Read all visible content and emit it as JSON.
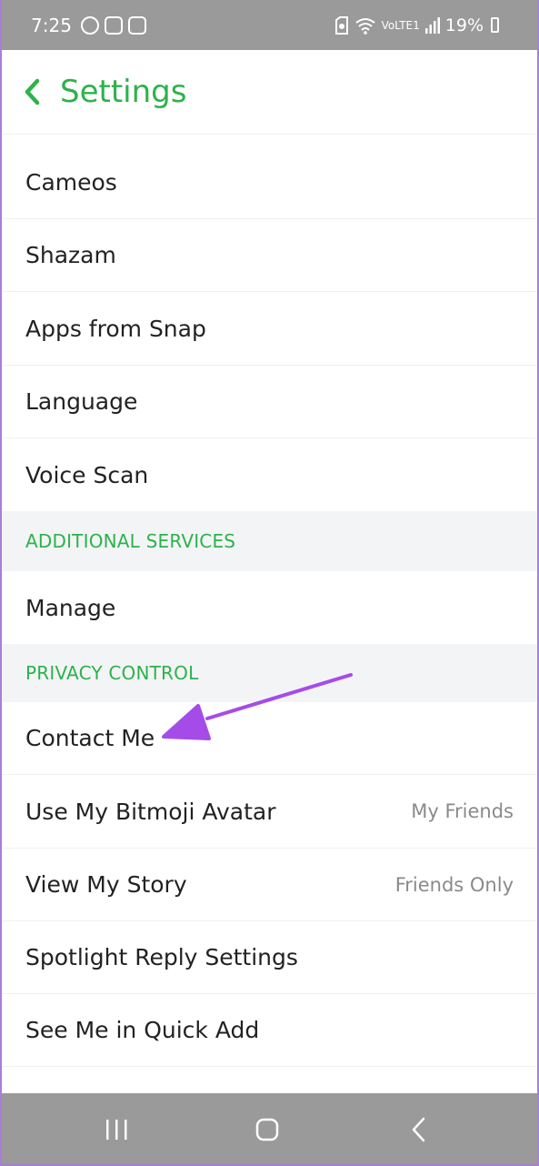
{
  "status_bar": {
    "time": "7:25",
    "battery": "19%",
    "network": "VoLTE1",
    "icons": [
      "whatsapp-icon",
      "instagram-icon",
      "gallery-icon",
      "sim-icon",
      "wifi-icon",
      "signal-icon",
      "battery-icon"
    ]
  },
  "header": {
    "title": "Settings",
    "back_icon": "chevron-left-icon"
  },
  "rows": [
    {
      "label": "Cameos",
      "value": ""
    },
    {
      "label": "Shazam",
      "value": ""
    },
    {
      "label": "Apps from Snap",
      "value": ""
    },
    {
      "label": "Language",
      "value": ""
    },
    {
      "label": "Voice Scan",
      "value": ""
    }
  ],
  "section_additional": "ADDITIONAL SERVICES",
  "manage": {
    "label": "Manage"
  },
  "section_privacy": "PRIVACY CONTROL",
  "privacy_rows": [
    {
      "label": "Contact Me",
      "value": ""
    },
    {
      "label": "Use My Bitmoji Avatar",
      "value": "My Friends"
    },
    {
      "label": "View My Story",
      "value": "Friends Only"
    },
    {
      "label": "Spotlight Reply Settings",
      "value": ""
    },
    {
      "label": "See Me in Quick Add",
      "value": ""
    }
  ],
  "nav": {
    "recents_icon": "recents-icon",
    "home_icon": "home-icon",
    "back_icon": "back-icon"
  },
  "colors": {
    "accent": "#2db24c",
    "annotation_arrow": "#a54ce8",
    "system_bar": "#9a9a9a"
  }
}
